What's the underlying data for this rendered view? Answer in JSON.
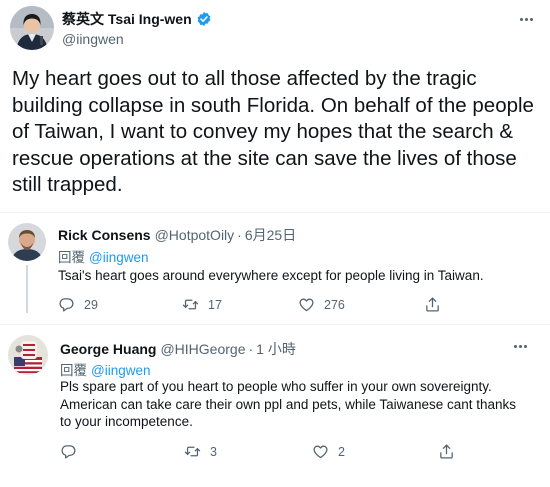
{
  "main_tweet": {
    "display_name": "蔡英文 Tsai Ing-wen",
    "handle": "@iingwen",
    "text": "My heart goes out to all those affected by the tragic building collapse in south Florida. On behalf of the people of Taiwan, I want to convey my hopes that the search & rescue operations at the site can save the lives of those still trapped."
  },
  "replies": [
    {
      "display_name": "Rick Consens",
      "handle": "@HotpotOily",
      "separator": "·",
      "time": "6月25日",
      "replying_label": "回覆",
      "replying_to": "@iingwen",
      "text": "Tsai's heart goes around everywhere except for people living in Taiwan.",
      "reply_count": "29",
      "retweet_count": "17",
      "like_count": "276"
    },
    {
      "display_name": "George Huang",
      "handle": "@HIHGeorge",
      "separator": "·",
      "time": "1 小時",
      "replying_label": "回覆",
      "replying_to": "@iingwen",
      "text": "Pls spare part of you heart to people who suffer in your own sovereignty. American can take care their own ppl and pets, while Taiwanese cant thanks to your incompetence.",
      "reply_count": "",
      "retweet_count": "3",
      "like_count": "2"
    }
  ],
  "colors": {
    "text": "#0f1419",
    "secondary": "#536471",
    "accent": "#1d9bf0",
    "divider": "#eff3f4"
  },
  "icons": {
    "verified": "verified-badge-icon",
    "more": "more-options-icon",
    "reply": "reply-icon",
    "retweet": "retweet-icon",
    "like": "heart-icon",
    "share": "share-icon"
  }
}
